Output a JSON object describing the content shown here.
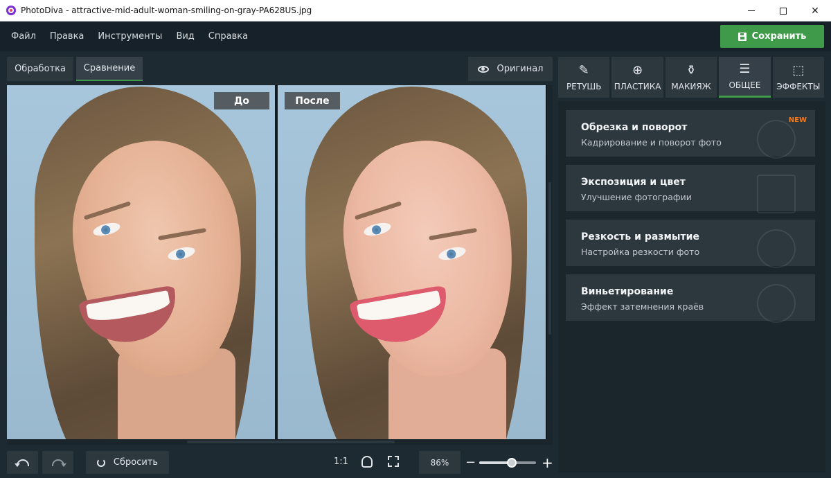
{
  "window": {
    "title": "PhotoDiva - attractive-mid-adult-woman-smiling-on-gray-PA628US.jpg",
    "minimize": "—",
    "maximize": "☐",
    "close": "✕"
  },
  "menu": {
    "items": [
      {
        "label": "Файл"
      },
      {
        "label": "Правка"
      },
      {
        "label": "Инструменты"
      },
      {
        "label": "Вид"
      },
      {
        "label": "Справка"
      }
    ],
    "save_label": "Сохранить"
  },
  "workspace": {
    "tabs": [
      {
        "label": "Обработка",
        "active": false
      },
      {
        "label": "Сравнение",
        "active": true
      }
    ],
    "original_label": "Оригинал",
    "before_label": "До",
    "after_label": "После"
  },
  "bottom": {
    "reset_label": "Сбросить",
    "one_to_one": "1:1",
    "zoom": "86%",
    "zoom_minus": "−",
    "zoom_plus": "+"
  },
  "tools": {
    "tabs": [
      {
        "label": "РЕТУШЬ",
        "icon": "retouch-icon",
        "glyph": "✎",
        "active": false
      },
      {
        "label": "ПЛАСТИКА",
        "icon": "plastic-icon",
        "glyph": "⊕",
        "active": false
      },
      {
        "label": "МАКИЯЖ",
        "icon": "makeup-icon",
        "glyph": "⚱",
        "active": false
      },
      {
        "label": "ОБЩЕЕ",
        "icon": "general-sliders-icon",
        "glyph": "☰",
        "active": true
      },
      {
        "label": "ЭФФЕКТЫ",
        "icon": "effects-icon",
        "glyph": "⬚",
        "active": false
      }
    ],
    "cards": [
      {
        "title": "Обрезка и поворот",
        "subtitle": "Кадрирование и поворот фото",
        "badge": "NEW"
      },
      {
        "title": "Экспозиция и цвет",
        "subtitle": "Улучшение фотографии",
        "badge": ""
      },
      {
        "title": "Резкость и размытие",
        "subtitle": "Настройка резкости фото",
        "badge": ""
      },
      {
        "title": "Виньетирование",
        "subtitle": "Эффект затемнения краёв",
        "badge": ""
      }
    ]
  },
  "colors": {
    "accent": "#3f9a4a",
    "new_badge": "#f07b1f",
    "background": "#1e2a31"
  }
}
